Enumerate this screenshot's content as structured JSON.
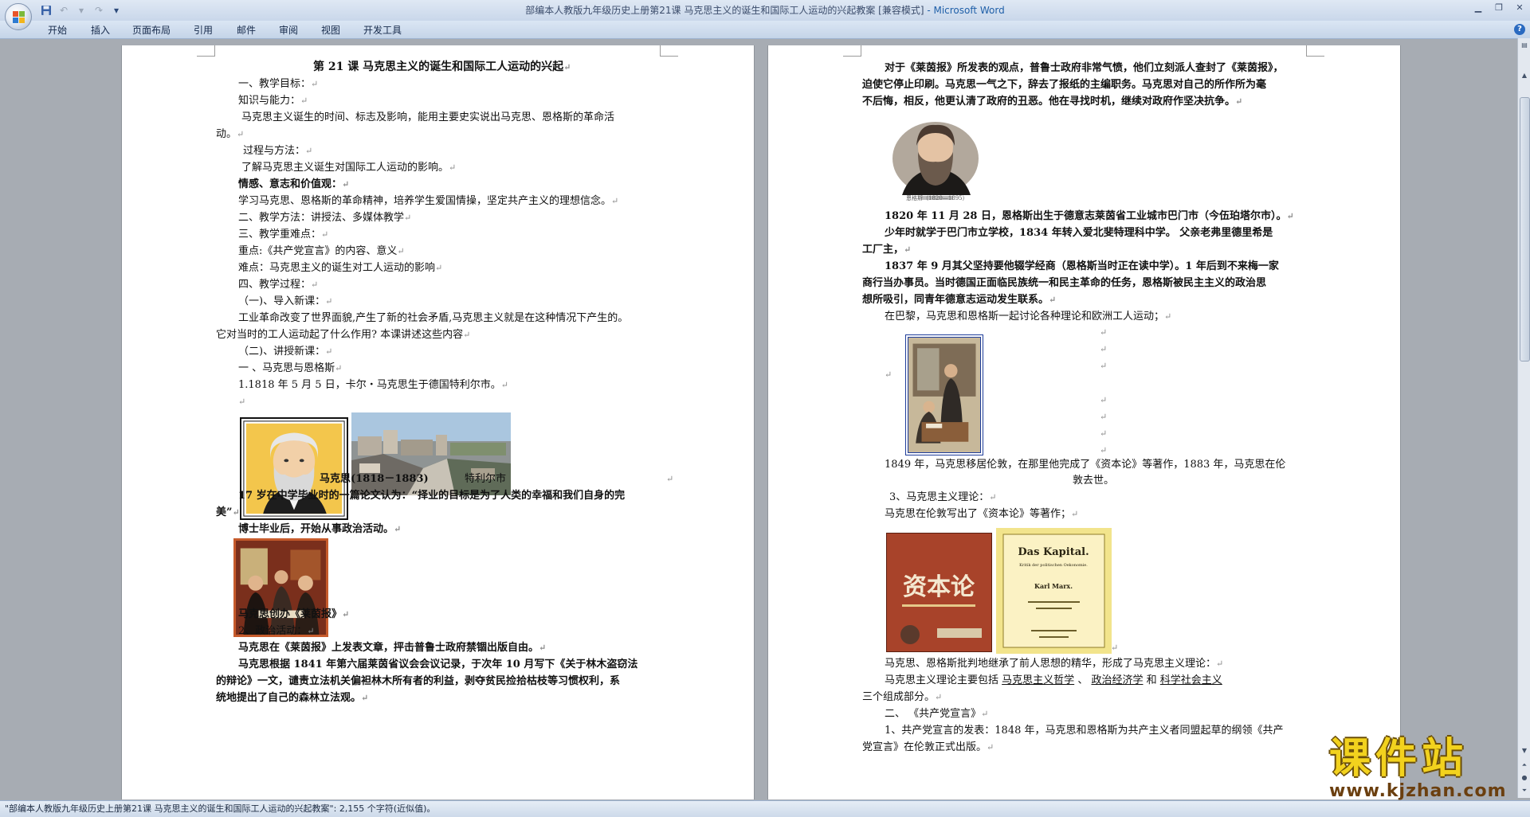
{
  "window": {
    "title": "部编本人教版九年级历史上册第21课 马克思主义的诞生和国际工人运动的兴起教案 [兼容模式]",
    "app_suffix": " - Microsoft Word",
    "help": "?"
  },
  "ribbon": {
    "tabs": [
      "开始",
      "插入",
      "页面布局",
      "引用",
      "邮件",
      "审阅",
      "视图",
      "开发工具"
    ]
  },
  "page1": {
    "lines": [
      "第 21 课   马克思主义的诞生和国际工人运动的兴起",
      "一、教学目标：",
      "知识与能力：",
      "马克思主义诞生的时间、标志及影响，能用主要史实说出马克思、恩格斯的革命活",
      "动。",
      "过程与方法：",
      "了解马克思主义诞生对国际工人运动的影响。",
      "情感、意志和价值观：",
      "学习马克思、恩格斯的革命精神，培养学生爱国情操，坚定共产主义的理想信念。",
      "二、教学方法：讲授法、多媒体教学",
      "三、教学重难点：",
      "重点:《共产党宣言》的内容、意义",
      "难点：马克思主义的诞生对工人运动的影响",
      "四、教学过程：",
      "（一)、导入新课：",
      "工业革命改变了世界面貌,产生了新的社会矛盾,马克思主义就是在这种情况下产生的。",
      "它对当时的工人运动起了什么作用? 本课讲述这些内容",
      "（二)、讲授新课：",
      "一  、马克思与恩格斯",
      "1.1818 年 5 月 5 日，卡尔・马克思生于德国特利尔市。",
      "马克思(1818－1883)",
      "特利尔市",
      "17 岁在中学毕业时的一篇论文认为：“择业的目标是为了人类的幸福和我们自身的完",
      "美”",
      "博士毕业后，开始从事政治活动。",
      "马克思创办《莱茵报》",
      "2、政治活动：",
      "马克思在《莱茵报》上发表文章，抨击普鲁士政府禁锢出版自由。",
      "马克思根据 1841 年第六届莱茵省议会会议记录，于次年 10 月写下《关于林木盗窃法",
      "的辩论》一文，谴责立法机关偏袒林木所有者的利益，剥夺贫民捡拾枯枝等习惯权利，系",
      "统地提出了自己的森林立法观。"
    ]
  },
  "page2": {
    "lines": [
      "对于《莱茵报》所发表的观点，普鲁士政府非常气愤，他们立刻派人查封了《莱茵报》，",
      "迫使它停止印刷。马克思一气之下，辞去了报纸的主编职务。马克思对自己的所作所为毫",
      "不后悔，相反，他更认清了政府的丑恶。他在寻找时机，继续对政府作坚决抗争。",
      "恩格斯（1820—1895）",
      "1820 年 11 月 28 日，恩格斯出生于德意志莱茵省工业城市巴门市（今伍珀塔尔市）。",
      "少年时就学于巴门市立学校，1834 年转入爱北斐特理科中学。 父亲老弗里德里希是",
      "工厂主，",
      "1837 年 9 月其父坚持要他辍学经商（恩格斯当时正在读中学）。1 年后到不来梅一家",
      "商行当办事员。当时德国正面临民族统一和民主革命的任务，恩格斯被民主主义的政治思",
      "想所吸引，同青年德意志运动发生联系。",
      "在巴黎，马克思和恩格斯一起讨论各种理论和欧洲工人运动；",
      "1849 年，马克思移居伦敦，在那里他完成了《资本论》等著作，1883 年，马克思在伦",
      "敦去世。",
      "3、马克思主义理论：",
      "马克思在伦敦写出了《资本论》等著作；",
      "马克思、恩格斯批判地继承了前人思想的精华，形成了马克思主义理论：",
      "马克思主义理论主要包括",
      "马克思主义哲学",
      "、",
      "政治经济学",
      "和",
      "科学社会主义",
      "三个组成部分。",
      "二、  《共产党宣言》",
      "1、共产党宣言的发表：1848 年，马克思和恩格斯为共产主义者同盟起草的纲领《共产",
      "党宣言》在伦敦正式出版。"
    ],
    "book_cover_cn": "资本论",
    "book_cover_de_title": "Das Kapital.",
    "book_cover_de_sub": "Kritik der politischen Oekonomie.",
    "book_cover_de_author": "Karl Marx."
  },
  "statusbar": {
    "text": "\"部编本人教版九年级历史上册第21课 马克思主义的诞生和国际工人运动的兴起教案\": 2,155 个字符(近似值)。"
  },
  "watermark": {
    "main": "课件站",
    "url": "www.kjzhan.com"
  },
  "symbols": {
    "para_mark": "↵"
  }
}
